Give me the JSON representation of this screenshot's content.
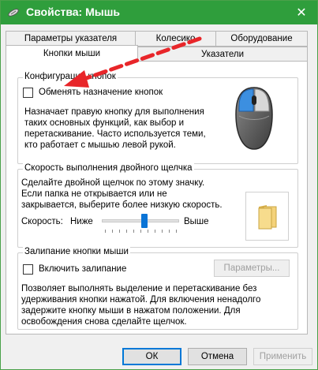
{
  "window": {
    "title": "Свойства: Мышь",
    "close_glyph": "✕"
  },
  "tabs": {
    "row1": [
      "Параметры указателя",
      "Колесико",
      "Оборудование"
    ],
    "row2": [
      "Кнопки мыши",
      "Указатели"
    ],
    "active": "Кнопки мыши"
  },
  "button_config": {
    "legend": "Конфигурация кнопок",
    "checkbox_label": "Обменять назначение кнопок",
    "checked": false,
    "description_lines": [
      "Назначает правую кнопку для выполнения",
      "таких основных функций, как выбор и",
      "перетаскивание. Часто используется теми,",
      "кто работает с мышью левой рукой."
    ]
  },
  "double_click": {
    "legend": "Скорость выполнения двойного щелчка",
    "description_lines": [
      "Сделайте двойной щелчок по этому значку.",
      "Если папка не открывается или не",
      "закрывается, выберите более низкую скорость."
    ],
    "speed_label": "Скорость:",
    "slow_label": "Ниже",
    "fast_label": "Выше",
    "speed_level": 0.55
  },
  "click_lock": {
    "legend": "Залипание кнопки мыши",
    "checkbox_label": "Включить залипание",
    "checked": false,
    "settings_button": "Параметры...",
    "description_lines": [
      "Позволяет выполнять выделение и перетаскивание без",
      "удерживания кнопки нажатой. Для включения ненадолго",
      "задержите кнопку мыши в нажатом положении. Для",
      "освобождения снова сделайте щелчок."
    ]
  },
  "footer": {
    "ok": "ОК",
    "cancel": "Отмена",
    "apply": "Применить"
  },
  "colors": {
    "titlebar": "#2f9e3c",
    "accent": "#0078d7",
    "annotation_arrow": "#e8262a"
  },
  "icons": {
    "title": "mouse-icon",
    "close": "close-icon",
    "mouse_illustration": "mouse-icon",
    "folder": "folder-icon",
    "annotation": "arrow-icon"
  }
}
